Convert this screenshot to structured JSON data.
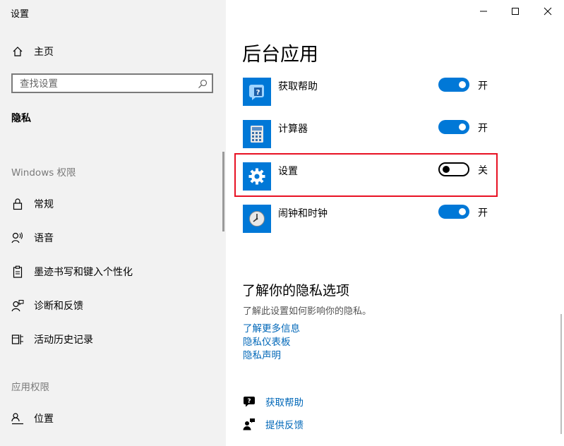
{
  "window": {
    "title": "设置"
  },
  "sidebar": {
    "home_label": "主页",
    "search_placeholder": "查找设置",
    "current_section": "隐私",
    "windows_permissions_header": "Windows 权限",
    "items": [
      {
        "label": "常规",
        "icon": "lock-icon"
      },
      {
        "label": "语音",
        "icon": "speech-icon"
      },
      {
        "label": "墨迹书写和键入个性化",
        "icon": "clipboard-pen-icon"
      },
      {
        "label": "诊断和反馈",
        "icon": "person-feedback-icon"
      },
      {
        "label": "活动历史记录",
        "icon": "timeline-icon"
      }
    ],
    "app_permissions_header": "应用权限",
    "app_items": [
      {
        "label": "位置",
        "icon": "location-person-icon"
      }
    ]
  },
  "main": {
    "title": "后台应用",
    "apps": [
      {
        "name": "获取帮助",
        "state": "开",
        "on": true,
        "icon": "get-help-app-icon"
      },
      {
        "name": "计算器",
        "state": "开",
        "on": true,
        "icon": "calculator-app-icon"
      },
      {
        "name": "设置",
        "state": "关",
        "on": false,
        "icon": "settings-gear-app-icon"
      },
      {
        "name": "闹钟和时钟",
        "state": "开",
        "on": true,
        "icon": "alarm-clock-app-icon"
      }
    ],
    "privacy": {
      "heading": "了解你的隐私选项",
      "description": "了解此设置如何影响你的隐私。",
      "links": [
        "了解更多信息",
        "隐私仪表板",
        "隐私声明"
      ]
    },
    "footer": {
      "get_help": "获取帮助",
      "give_feedback": "提供反馈"
    }
  },
  "colors": {
    "accent": "#0078d7",
    "link": "#0067b8",
    "highlight": "#e81123"
  }
}
